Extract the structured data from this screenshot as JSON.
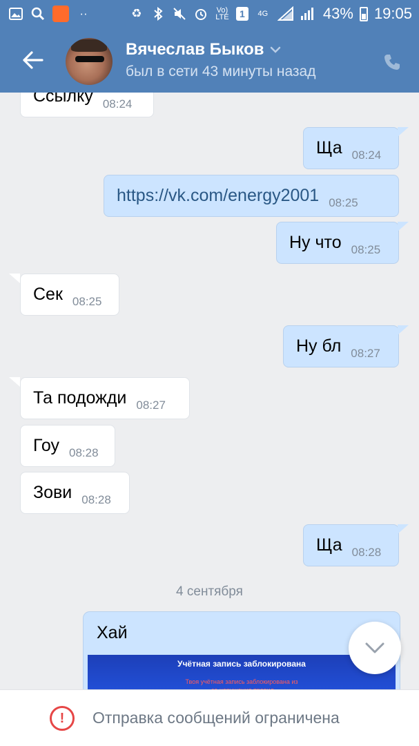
{
  "status_bar": {
    "network": "4G",
    "sim": "1",
    "volte": "Vo) LTE",
    "battery": "43%",
    "time": "19:05"
  },
  "header": {
    "name": "Вячеслав Быков",
    "status": "был в сети 43 минуты назад"
  },
  "messages": [
    {
      "dir": "in",
      "text": "Ссылку",
      "time": "08:24"
    },
    {
      "dir": "out",
      "text": "Ща",
      "time": "08:24"
    },
    {
      "dir": "out",
      "text": "https://vk.com/energy2001",
      "time": "08:25"
    },
    {
      "dir": "out",
      "text": "Ну что",
      "time": "08:25"
    },
    {
      "dir": "in",
      "text": "Сек",
      "time": "08:25"
    },
    {
      "dir": "out",
      "text": "Ну бл",
      "time": "08:27"
    },
    {
      "dir": "in",
      "text": "Та подожди",
      "time": "08:27"
    },
    {
      "dir": "in",
      "text": "Гоу",
      "time": "08:28"
    },
    {
      "dir": "in",
      "text": "Зови",
      "time": "08:28"
    },
    {
      "dir": "out",
      "text": "Ща",
      "time": "08:28"
    }
  ],
  "date_separator": "4 сентября",
  "last_message": {
    "text": "Хай",
    "attachment_title": "Учётная запись заблокирована",
    "attachment_line1": "Твоя учётная запись заблокирована из",
    "attachment_line2": "-за нарушения правил"
  },
  "bottom": {
    "restriction_text": "Отправка сообщений ограничена"
  },
  "colors": {
    "header": "#5181b8",
    "incoming_bubble": "#ffffff",
    "outgoing_bubble": "#cce4ff",
    "background": "#edeef0",
    "warning": "#e64646"
  }
}
